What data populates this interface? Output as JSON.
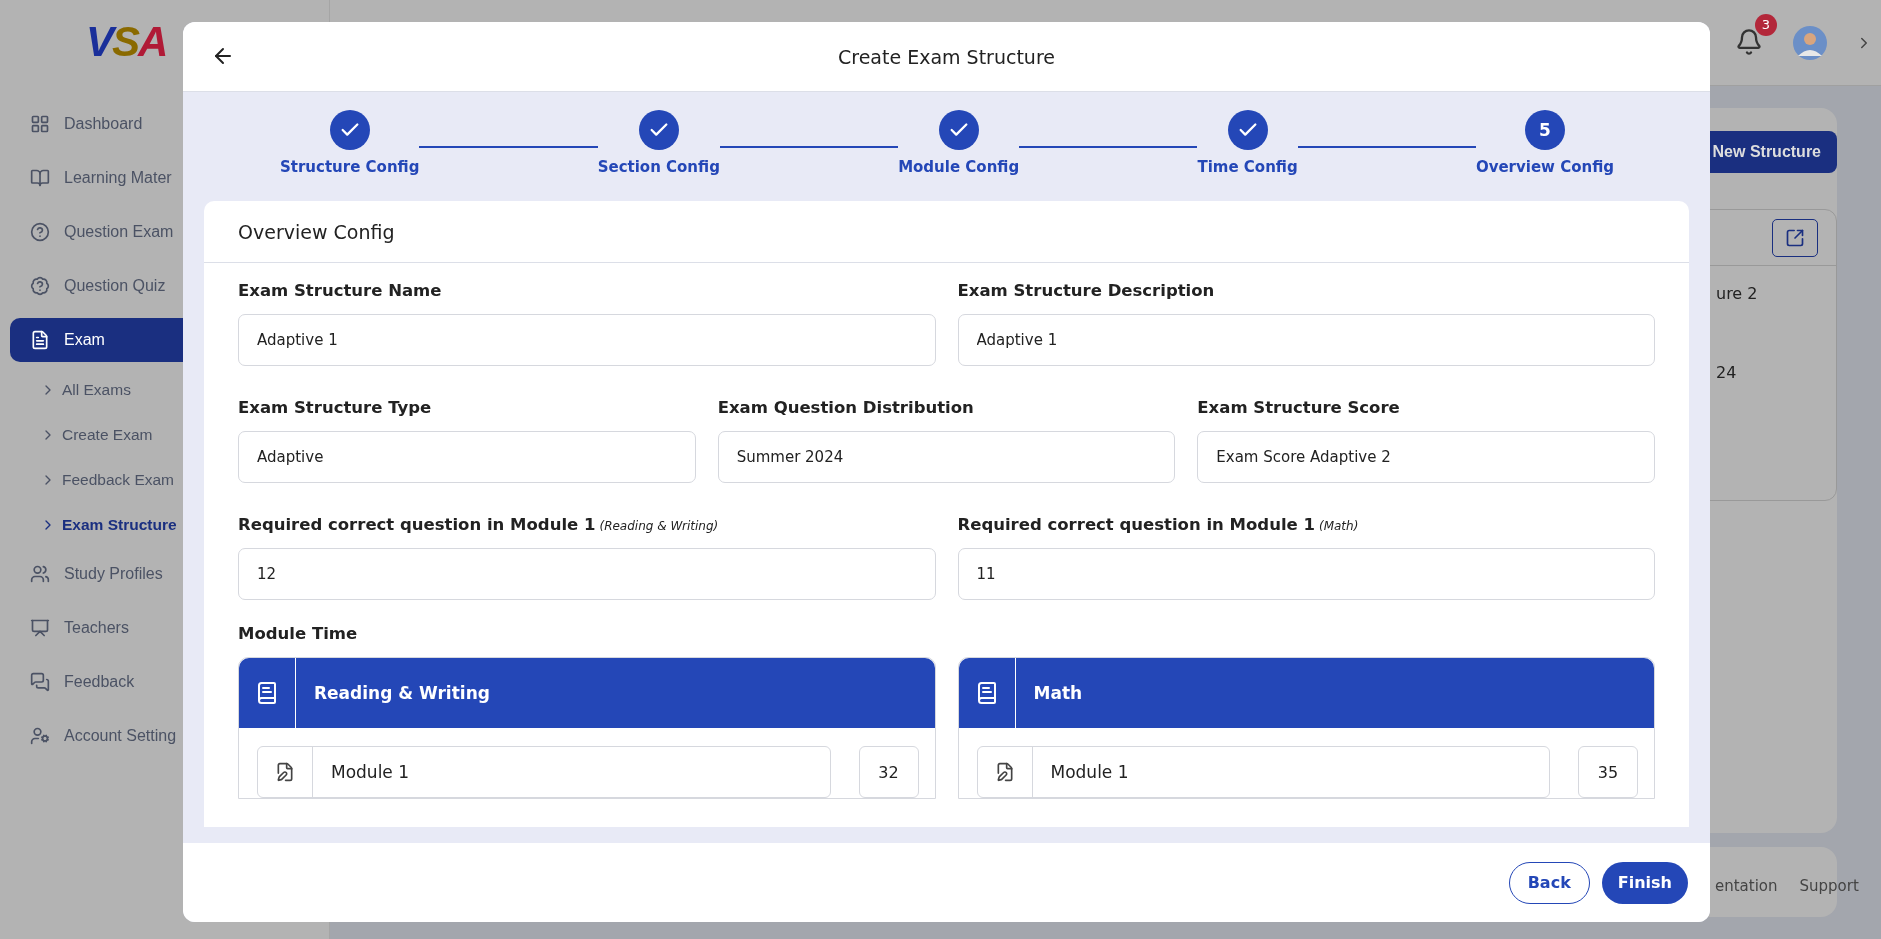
{
  "logo": {
    "letters": [
      "V",
      "S",
      "A"
    ]
  },
  "sidebar": {
    "items": [
      {
        "label": "Dashboard",
        "selected": false
      },
      {
        "label": "Learning Mater",
        "selected": false
      },
      {
        "label": "Question Exam",
        "selected": false
      },
      {
        "label": "Question Quiz",
        "selected": false
      },
      {
        "label": "Exam",
        "selected": true,
        "children": [
          {
            "label": "All Exams",
            "selected": false
          },
          {
            "label": "Create Exam",
            "selected": false
          },
          {
            "label": "Feedback Exam",
            "selected": false
          },
          {
            "label": "Exam Structure",
            "selected": true
          }
        ]
      },
      {
        "label": "Study Profiles",
        "selected": false
      },
      {
        "label": "Teachers",
        "selected": false
      },
      {
        "label": "Feedback",
        "selected": false
      },
      {
        "label": "Account Setting",
        "selected": false
      }
    ]
  },
  "topbar": {
    "notification_count": "3"
  },
  "background": {
    "new_button": "New Structure",
    "card_lines": [
      "ure 2",
      "24"
    ],
    "footer_links": [
      "entation",
      "Support"
    ]
  },
  "modal": {
    "title": "Create Exam Structure",
    "steps": [
      {
        "label": "Structure Config",
        "completed": true
      },
      {
        "label": "Section Config",
        "completed": true
      },
      {
        "label": "Module Config",
        "completed": true
      },
      {
        "label": "Time Config",
        "completed": true
      },
      {
        "label": "Overview Config",
        "completed": false,
        "number": "5"
      }
    ],
    "section_title": "Overview Config",
    "field_rows": [
      [
        {
          "label": "Exam Structure Name",
          "value": "Adaptive 1"
        },
        {
          "label": "Exam Structure Description",
          "value": "Adaptive 1"
        }
      ],
      [
        {
          "label": "Exam Structure Type",
          "value": "Adaptive"
        },
        {
          "label": "Exam Question Distribution",
          "value": "Summer 2024"
        },
        {
          "label": "Exam Structure Score",
          "value": "Exam Score Adaptive 2"
        }
      ],
      [
        {
          "label": "Required correct question in Module 1",
          "note": "(Reading & Writing)",
          "value": "12"
        },
        {
          "label": "Required correct question in Module 1",
          "note": "(Math)",
          "value": "11"
        }
      ]
    ],
    "module_time_label": "Module Time",
    "module_panels": [
      {
        "title": "Reading & Writing",
        "modules": [
          {
            "name": "Module 1",
            "time": "32"
          }
        ]
      },
      {
        "title": "Math",
        "modules": [
          {
            "name": "Module 1",
            "time": "35"
          }
        ]
      }
    ],
    "buttons": {
      "back": "Back",
      "finish": "Finish"
    }
  }
}
